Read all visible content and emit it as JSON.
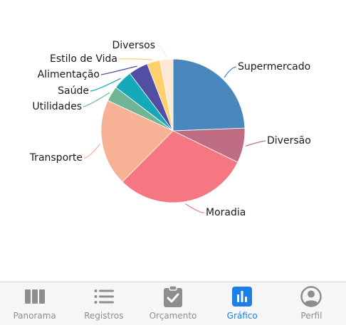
{
  "chart_data": {
    "type": "pie",
    "slices": [
      {
        "label": "Supermercado",
        "value": 25,
        "color": "#4a87bd"
      },
      {
        "label": "Diversão",
        "value": 8,
        "color": "#bf6d82"
      },
      {
        "label": "Moradia",
        "value": 31,
        "color": "#f47782"
      },
      {
        "label": "Transporte",
        "value": 20,
        "color": "#f7b195"
      },
      {
        "label": "Utilidades",
        "value": 3.5,
        "color": "#6fb595"
      },
      {
        "label": "Saúde",
        "value": 4.5,
        "color": "#14a8b8"
      },
      {
        "label": "Alimentação",
        "value": 4.5,
        "color": "#514ea3"
      },
      {
        "label": "Estilo de Vida",
        "value": 3,
        "color": "#ffd06b"
      },
      {
        "label": "Diversos",
        "value": 3,
        "color": "#fde9d8"
      }
    ]
  },
  "tabbar": {
    "tabs": [
      {
        "label": "Panorama",
        "icon": "columns-icon"
      },
      {
        "label": "Registros",
        "icon": "list-icon"
      },
      {
        "label": "Orçamento",
        "icon": "clipboard-check-icon"
      },
      {
        "label": "Gráfico",
        "icon": "bar-chart-icon",
        "active": true
      },
      {
        "label": "Perfil",
        "icon": "user-circle-icon"
      }
    ],
    "active_color": "#1a7fe8",
    "inactive_color": "#8e8e8e"
  }
}
